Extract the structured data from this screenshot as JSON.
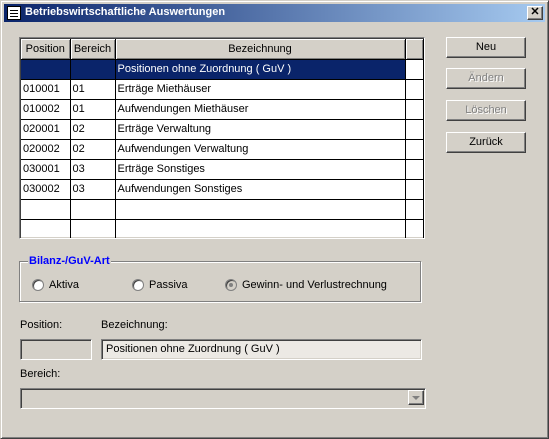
{
  "window": {
    "title": "Betriebswirtschaftliche Auswertungen",
    "close_glyph": "✕"
  },
  "grid": {
    "headers": [
      "Position",
      "Bereich",
      "Bezeichnung"
    ],
    "rows": [
      [
        "",
        "",
        "Positionen ohne Zuordnung  ( GuV )"
      ],
      [
        "010001",
        "01",
        "Erträge Miethäuser"
      ],
      [
        "010002",
        "01",
        "Aufwendungen Miethäuser"
      ],
      [
        "020001",
        "02",
        "Erträge Verwaltung"
      ],
      [
        "020002",
        "02",
        "Aufwendungen Verwaltung"
      ],
      [
        "030001",
        "03",
        "Erträge Sonstiges"
      ],
      [
        "030002",
        "03",
        "Aufwendungen Sonstiges"
      ],
      [
        "",
        "",
        ""
      ],
      [
        "",
        "",
        ""
      ]
    ]
  },
  "buttons": {
    "neu": "Neu",
    "aendern": "Ändern",
    "loeschen": "Löschen",
    "zurueck": "Zurück"
  },
  "group": {
    "title": "Bilanz-/GuV-Art",
    "options": [
      "Aktiva",
      "Passiva",
      "Gewinn- und Verlustrechnung"
    ],
    "selected": "Gewinn- und Verlustrechnung"
  },
  "form": {
    "position_label": "Position:",
    "position_value": "",
    "bezeichnung_label": "Bezeichnung:",
    "bezeichnung_value": "Positionen ohne Zuordnung  ( GuV )",
    "bereich_label": "Bereich:",
    "bereich_value": ""
  },
  "colors": {
    "selection": "#0a246a",
    "group_title": "#0000ff",
    "titlebar": "#0a246a"
  }
}
